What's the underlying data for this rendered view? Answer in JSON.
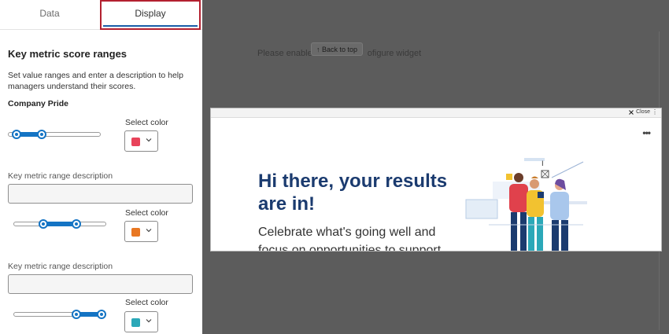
{
  "tabs": [
    {
      "label": "Data"
    },
    {
      "label": "Display"
    }
  ],
  "section": {
    "title": "Key metric score ranges",
    "description": "Set value ranges and enter a description to help managers understand their scores.",
    "metric_name": "Company Pride"
  },
  "ranges": [
    {
      "select_color_label": "Select color",
      "color": "#e8435a",
      "low": 0.05,
      "high": 0.35
    },
    {
      "description_label": "Key metric range description",
      "description_value": "",
      "select_color_label": "Select color",
      "color": "#e87722",
      "low": 0.3,
      "high": 0.7
    },
    {
      "description_label": "Key metric range description",
      "description_value": "",
      "select_color_label": "Select color",
      "color": "#2ba8b8",
      "low": 0.7,
      "high": 1.0
    }
  ],
  "background": {
    "widget_text_left": "Please enable",
    "widget_text_right": "ofigure widget",
    "back_to_top": "↑ Back to top"
  },
  "widget": {
    "close_label": "Close",
    "title": "Hi there, your results are in!",
    "subtitle": "Celebrate what's going well and focus on opportunities to support"
  },
  "colors": {
    "accent": "#1474c4",
    "tab_highlight": "#b3202f",
    "title": "#1b3b6f"
  }
}
